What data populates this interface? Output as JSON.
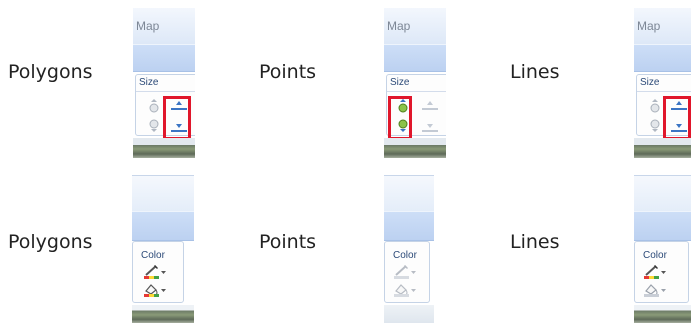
{
  "labels": {
    "top_left": "Polygons",
    "top_middle": "Points",
    "top_right": "Lines",
    "bottom_left": "Polygons",
    "bottom_middle": "Points",
    "bottom_right": "Lines"
  },
  "size_panel": {
    "title": "Map",
    "group_label": "Size",
    "icons": [
      "increase-size-icon",
      "decrease-size-icon"
    ]
  },
  "color_panel": {
    "group_label": "Color",
    "icons": [
      "pen-color-icon",
      "fill-color-icon"
    ]
  },
  "colors": {
    "highlight": "#e0162b",
    "ribbon_blue": "#cddef7",
    "point_green": "#7cb342"
  }
}
